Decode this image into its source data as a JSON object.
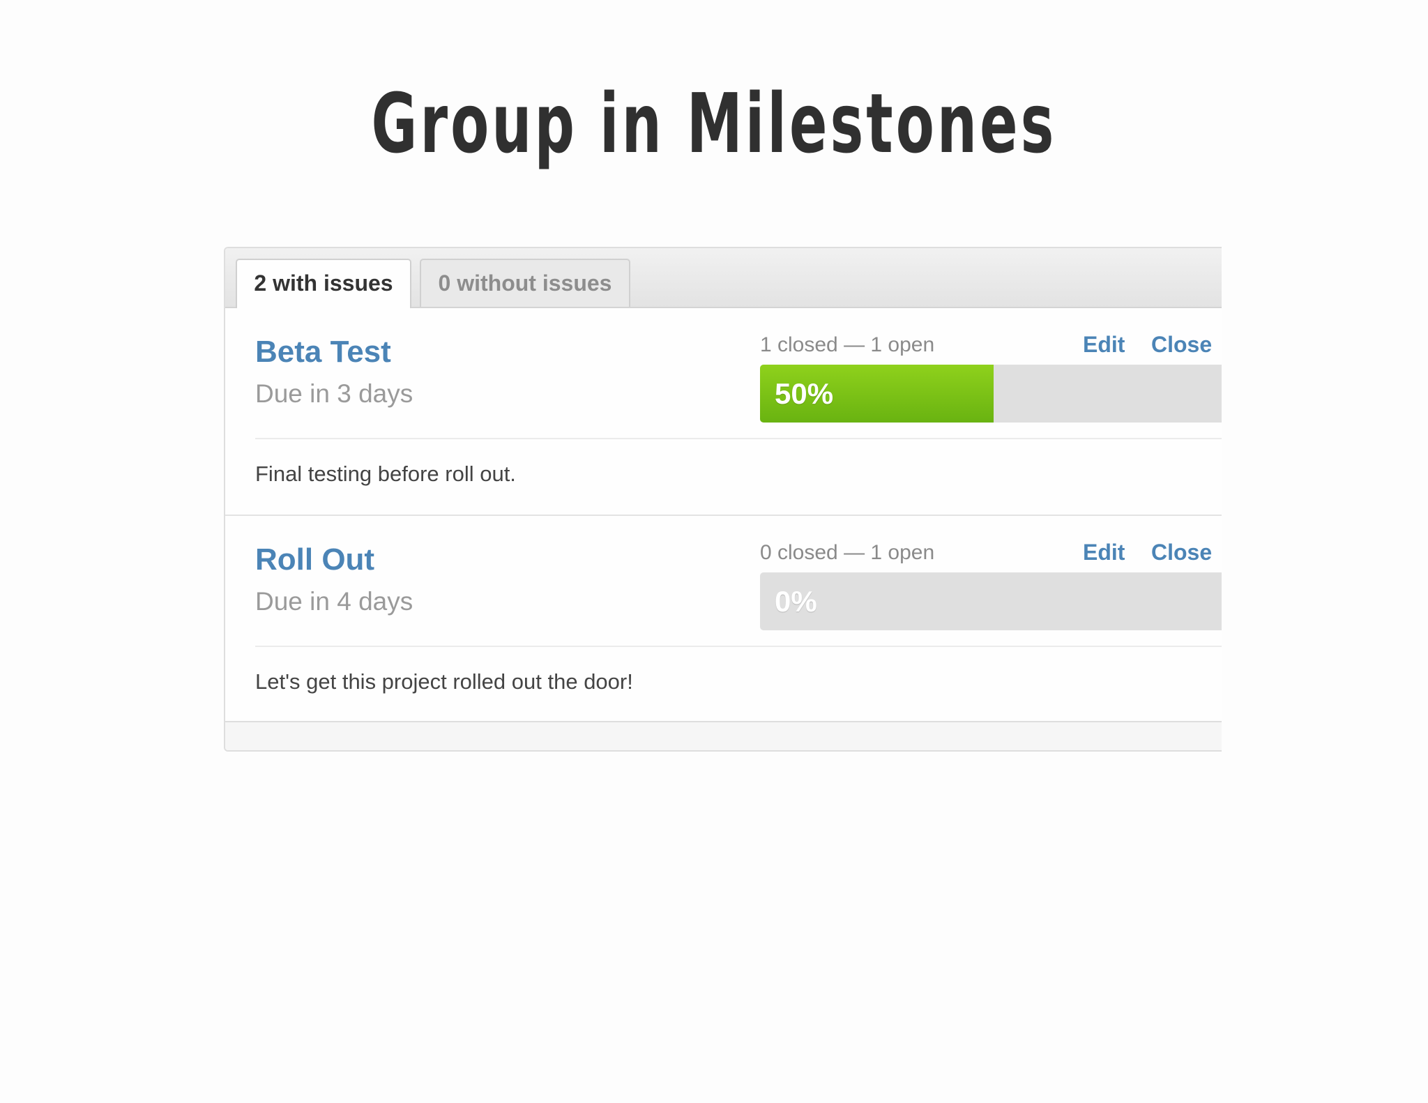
{
  "slide": {
    "title": "Group in Milestones"
  },
  "tabs": [
    {
      "label": "2 with issues",
      "active": true
    },
    {
      "label": "0 without issues",
      "active": false
    }
  ],
  "milestones": [
    {
      "title": "Beta Test",
      "due": "Due in 3 days",
      "stats": "1 closed — 1 open",
      "edit_label": "Edit",
      "close_label": "Close",
      "progress_label": "50%",
      "progress": 0.5,
      "description": "Final testing before roll out."
    },
    {
      "title": "Roll Out",
      "due": "Due in 4 days",
      "stats": "0 closed — 1 open",
      "edit_label": "Edit",
      "close_label": "Close",
      "progress_label": "0%",
      "progress": 0,
      "description": "Let's get this project rolled out the door!"
    }
  ],
  "colors": {
    "link": "#4b84b6",
    "progress_fill": "#7ec318",
    "progress_track": "#dfdfdf"
  }
}
